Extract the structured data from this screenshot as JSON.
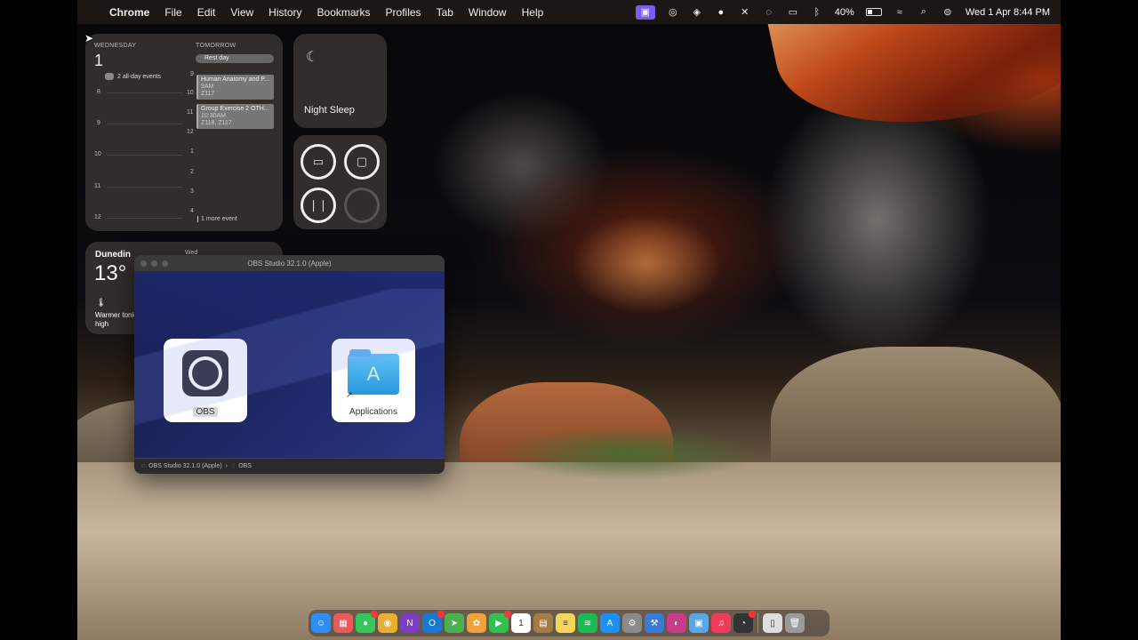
{
  "menubar": {
    "app_name": "Chrome",
    "menus": [
      "File",
      "Edit",
      "View",
      "History",
      "Bookmarks",
      "Profiles",
      "Tab",
      "Window",
      "Help"
    ],
    "battery": "40%",
    "battery_level": 0.4,
    "datetime": "Wed 1 Apr  8:44 PM"
  },
  "calendar": {
    "today_label": "WEDNESDAY",
    "today_num": "1",
    "all_day": "2 all-day events",
    "tomorrow_label": "TOMORROW",
    "rest_day": "Rest day",
    "left_hours": [
      "8",
      "9",
      "10",
      "11",
      "12"
    ],
    "right_hours": [
      "9",
      "10",
      "11",
      "12",
      "1",
      "2",
      "3",
      "4"
    ],
    "events": [
      {
        "title": "Human Anatomy and P...",
        "time": "9AM",
        "room": "Z117"
      },
      {
        "title": "Group Exercise 2 OTH...",
        "time": "10:30AM",
        "room": "Z118, Z117"
      }
    ],
    "more": "1 more event"
  },
  "sleep": {
    "label": "Night Sleep"
  },
  "weather": {
    "city": "Dunedin",
    "temp": "13°",
    "desc": "Warmer tonight, with a high",
    "day": "Wed"
  },
  "finder": {
    "title": "OBS Studio 32.1.0 (Apple)",
    "items": [
      {
        "label": "OBS"
      },
      {
        "label": "Applications"
      }
    ],
    "path_root": "OBS Studio 32.1.0 (Apple)",
    "path_child": "OBS"
  },
  "dock": {
    "apps": [
      {
        "name": "finder-icon",
        "color": "#2f8ef5",
        "glyph": "☺"
      },
      {
        "name": "launchpad-icon",
        "color": "#e85b5b",
        "glyph": "▦"
      },
      {
        "name": "messages-icon",
        "color": "#34c759",
        "glyph": "●"
      },
      {
        "name": "chrome-icon",
        "color": "#e8b030",
        "glyph": "◉"
      },
      {
        "name": "onenote-icon",
        "color": "#7b3fbf",
        "glyph": "N"
      },
      {
        "name": "outlook-icon",
        "color": "#1979d2",
        "glyph": "O"
      },
      {
        "name": "maps-icon",
        "color": "#4cb050",
        "glyph": "➤"
      },
      {
        "name": "photos-icon",
        "color": "#f0a23a",
        "glyph": "✿"
      },
      {
        "name": "facetime-icon",
        "color": "#30c050",
        "glyph": "▶"
      },
      {
        "name": "calendar-icon",
        "color": "#ffffff",
        "glyph": "1"
      },
      {
        "name": "notes-brown-icon",
        "color": "#a57c46",
        "glyph": "▤"
      },
      {
        "name": "notes-icon",
        "color": "#f6d65a",
        "glyph": "≡"
      },
      {
        "name": "spotify-icon",
        "color": "#1db954",
        "glyph": "≋"
      },
      {
        "name": "app-store-icon",
        "color": "#1e90f5",
        "glyph": "A"
      },
      {
        "name": "settings-icon",
        "color": "#8a8a8a",
        "glyph": "⚙"
      },
      {
        "name": "xcode-icon",
        "color": "#3a7bd5",
        "glyph": "⚒"
      },
      {
        "name": "arc-icon",
        "color": "#c93b8a",
        "glyph": "◐"
      },
      {
        "name": "preview-icon",
        "color": "#5aa7e8",
        "glyph": "▣"
      },
      {
        "name": "music-icon",
        "color": "#f23b5c",
        "glyph": "♫"
      },
      {
        "name": "activity-monitor-icon",
        "color": "#333333",
        "glyph": "◔"
      }
    ],
    "right_apps": [
      {
        "name": "document-icon",
        "color": "#dddddd",
        "glyph": "▯"
      },
      {
        "name": "trash-icon",
        "color": "#9a9a9a",
        "glyph": "🗑"
      }
    ]
  }
}
